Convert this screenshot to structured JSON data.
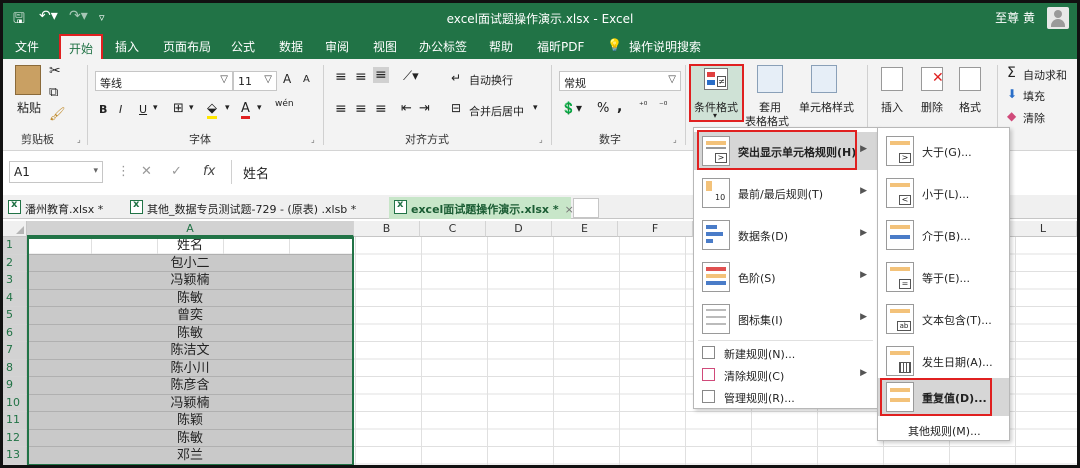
{
  "titlebar": {
    "doc_title": "excel面试题操作演示.xlsx  -  Excel",
    "user": "至尊 黄"
  },
  "menu": [
    "文件",
    "开始",
    "插入",
    "页面布局",
    "公式",
    "数据",
    "审阅",
    "视图",
    "办公标签",
    "帮助",
    "福昕PDF",
    "操作说明搜索"
  ],
  "active_menu": "开始",
  "ribbon": {
    "clipboard": {
      "paste": "粘贴",
      "label": "剪贴板"
    },
    "font": {
      "name": "等线",
      "size": "11",
      "label": "字体",
      "bold": "B",
      "italic": "I",
      "underline": "U",
      "grow": "A",
      "shrink": "A",
      "phonetic": "wén"
    },
    "alignment": {
      "wrap": "自动换行",
      "merge": "合并后居中",
      "label": "对齐方式"
    },
    "number": {
      "format": "常规",
      "percent": "%",
      "comma": ",",
      "label": "数字"
    },
    "styles": {
      "conditional": "条件格式",
      "table": "套用",
      "table2": "表格格式",
      "cell_styles": "单元格样式"
    },
    "cells": {
      "insert": "插入",
      "delete": "删除",
      "format": "格式"
    },
    "editing": {
      "autosum": "自动求和",
      "fill": "填充",
      "clear": "清除"
    }
  },
  "formula_bar": {
    "cell_ref": "A1",
    "content": "姓名"
  },
  "workbook_tabs": [
    {
      "label": "潘州教育.xlsx *"
    },
    {
      "label": "其他_数据专员测试题-729 -  (原表) .xlsb *"
    },
    {
      "label": "excel面试题操作演示.xlsx *",
      "close": "×"
    }
  ],
  "grid": {
    "columns": [
      "A",
      "B",
      "C",
      "D",
      "E",
      "F",
      "L"
    ],
    "row_numbers": [
      "1",
      "2",
      "3",
      "4",
      "5",
      "6",
      "7",
      "8",
      "9",
      "10",
      "11",
      "12",
      "13"
    ],
    "cells_A": [
      "姓名",
      "包小二",
      "冯颖楠",
      "陈敏",
      "曾奕",
      "陈敏",
      "陈洁文",
      "陈小川",
      "陈彦含",
      "冯颖楠",
      "陈颖",
      "陈敏",
      "邓兰"
    ]
  },
  "cond_menu": {
    "highlight": "突出显示单元格规则(H)",
    "topbottom": "最前/最后规则(T)",
    "databar": "数据条(D)",
    "colorscale": "色阶(S)",
    "iconset": "图标集(I)",
    "new_rule": "新建规则(N)...",
    "clear_rule": "清除规则(C)",
    "manage_rule": "管理规则(R)..."
  },
  "highlight_submenu": {
    "greater": "大于(G)...",
    "less": "小于(L)...",
    "between": "介于(B)...",
    "equal": "等于(E)...",
    "text_contains": "文本包含(T)...",
    "date": "发生日期(A)...",
    "duplicate": "重复值(D)...",
    "more": "其他规则(M)..."
  },
  "icon_text": {
    "gt": ">",
    "lt": "<",
    "eq": "=",
    "ab": "ab",
    "top10": "10"
  },
  "colors": {
    "excel_green": "#217346",
    "highlight_red": "#e02020",
    "selected_gray": "#c9c9c9"
  }
}
